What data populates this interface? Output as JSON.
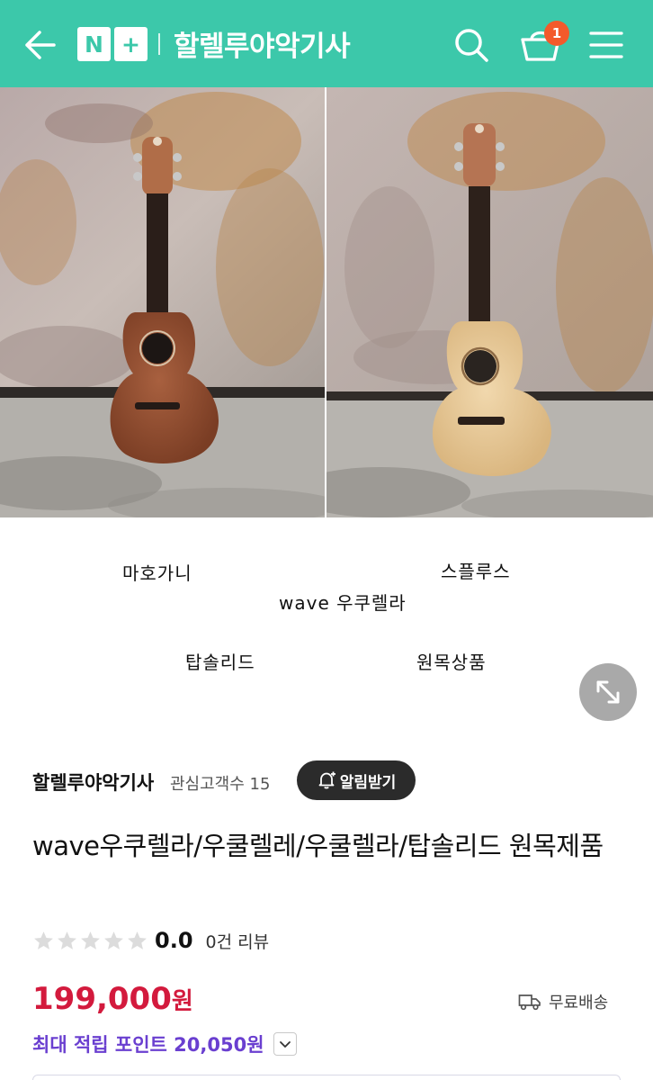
{
  "header": {
    "logo_left": "N",
    "logo_right": "+",
    "store_name": "할렐루야악기사",
    "cart_count": "1",
    "bg_color": "#3cc8aa"
  },
  "gallery": {
    "captions": {
      "left_top": "마호가니",
      "right_top": "스플루스",
      "center": "wave 우쿠렐라",
      "left_bottom": "탑솔리드",
      "right_bottom": "원목상품"
    }
  },
  "seller": {
    "name": "할렐루야악기사",
    "follow_label": "관심고객수 15",
    "alarm_label": "알림받기"
  },
  "product": {
    "title": "wave우쿠렐라/우쿨렐레/우쿨렐라/탑솔리드 원목제품",
    "rating": {
      "stars_filled": 0,
      "stars_total": 5,
      "score": "0.0",
      "reviews": "0건 리뷰"
    },
    "price": {
      "amount": "199,000",
      "unit": "원",
      "color": "#d31a3d"
    },
    "shipping": "무료배송",
    "points": "최대 적립 포인트 20,050원",
    "points_color": "#6a3fd0"
  }
}
